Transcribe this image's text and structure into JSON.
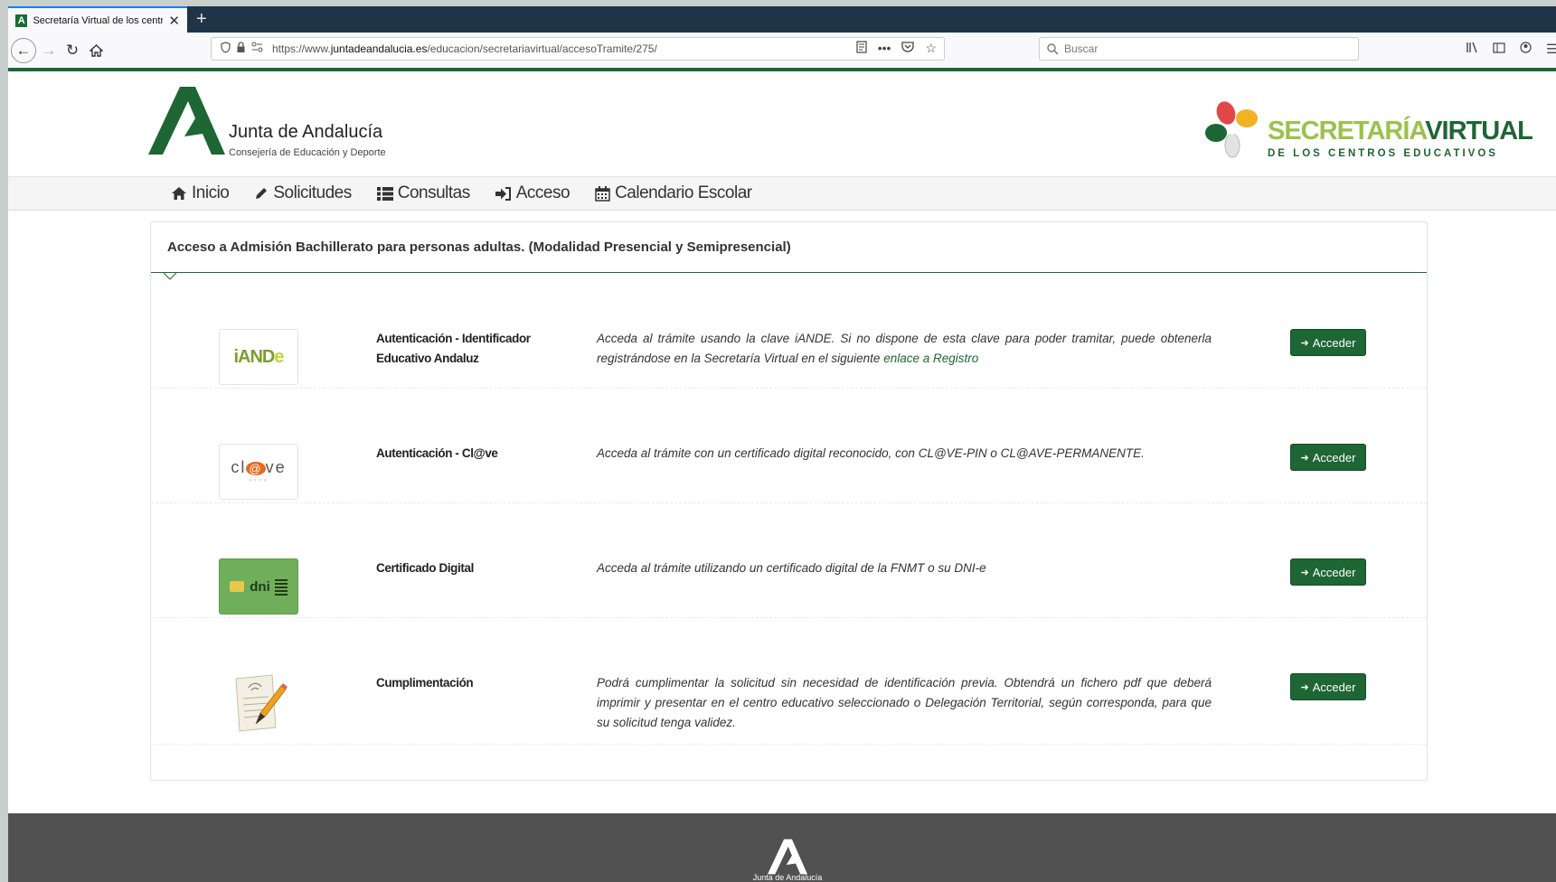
{
  "browser": {
    "tab_title": "Secretaría Virtual de los centros",
    "url_prefix": "https://www.",
    "url_domain": "juntadeandalucia.es",
    "url_path": "/educacion/secretariavirtual/accesoTramite/275/",
    "search_placeholder": "Buscar"
  },
  "header": {
    "brand_title": "Junta de Andalucía",
    "brand_subtitle": "Consejería de Educación y Deporte",
    "sv_title_a": "SECRETARÍA",
    "sv_title_b": "VIRTUAL",
    "sv_subtitle": "DE LOS CENTROS EDUCATIVOS"
  },
  "menu": {
    "items": [
      {
        "label": "Inicio",
        "icon": "home-icon"
      },
      {
        "label": "Solicitudes",
        "icon": "pencil-icon"
      },
      {
        "label": "Consultas",
        "icon": "list-icon"
      },
      {
        "label": "Acceso",
        "icon": "sign-in-icon"
      },
      {
        "label": "Calendario Escolar",
        "icon": "calendar-icon"
      }
    ]
  },
  "panel": {
    "title": "Acceso a Admisión Bachillerato para personas adultas. (Modalidad Presencial y Semipresencial)",
    "button_label": "Acceder",
    "rows": [
      {
        "logo": "iANDe",
        "title": "Autenticación - Identificador Educativo Andaluz",
        "desc": "Acceda al trámite usando la clave iANDE. Si no dispone de esta clave para poder tramitar, puede obtenerla registrándose en la Secretaría Virtual en el siguiente",
        "link": "enlace a Registro"
      },
      {
        "logo_a": "cl",
        "logo_b": "ve",
        "title": "Autenticación - Cl@ve",
        "desc": "Acceda al trámite con un certificado digital reconocido, con CL@VE-PIN o CL@AVE-PERMANENTE."
      },
      {
        "logo": "dni",
        "title": "Certificado Digital",
        "desc": "Acceda al trámite utilizando un certificado digital de la FNMT o su DNI-e"
      },
      {
        "title": "Cumplimentación",
        "desc": "Podrá cumplimentar la solicitud sin necesidad de identificación previa. Obtendrá un fichero pdf que deberá imprimir y presentar en el centro educativo seleccionado o Delegación Territorial, según corresponda, para que su solicitud tenga validez."
      }
    ]
  },
  "footer": {
    "text": "Junta de Andalucía"
  },
  "colors": {
    "primary_green": "#1e6634",
    "light_green": "#9bc24d",
    "footer_gray": "#515151"
  }
}
